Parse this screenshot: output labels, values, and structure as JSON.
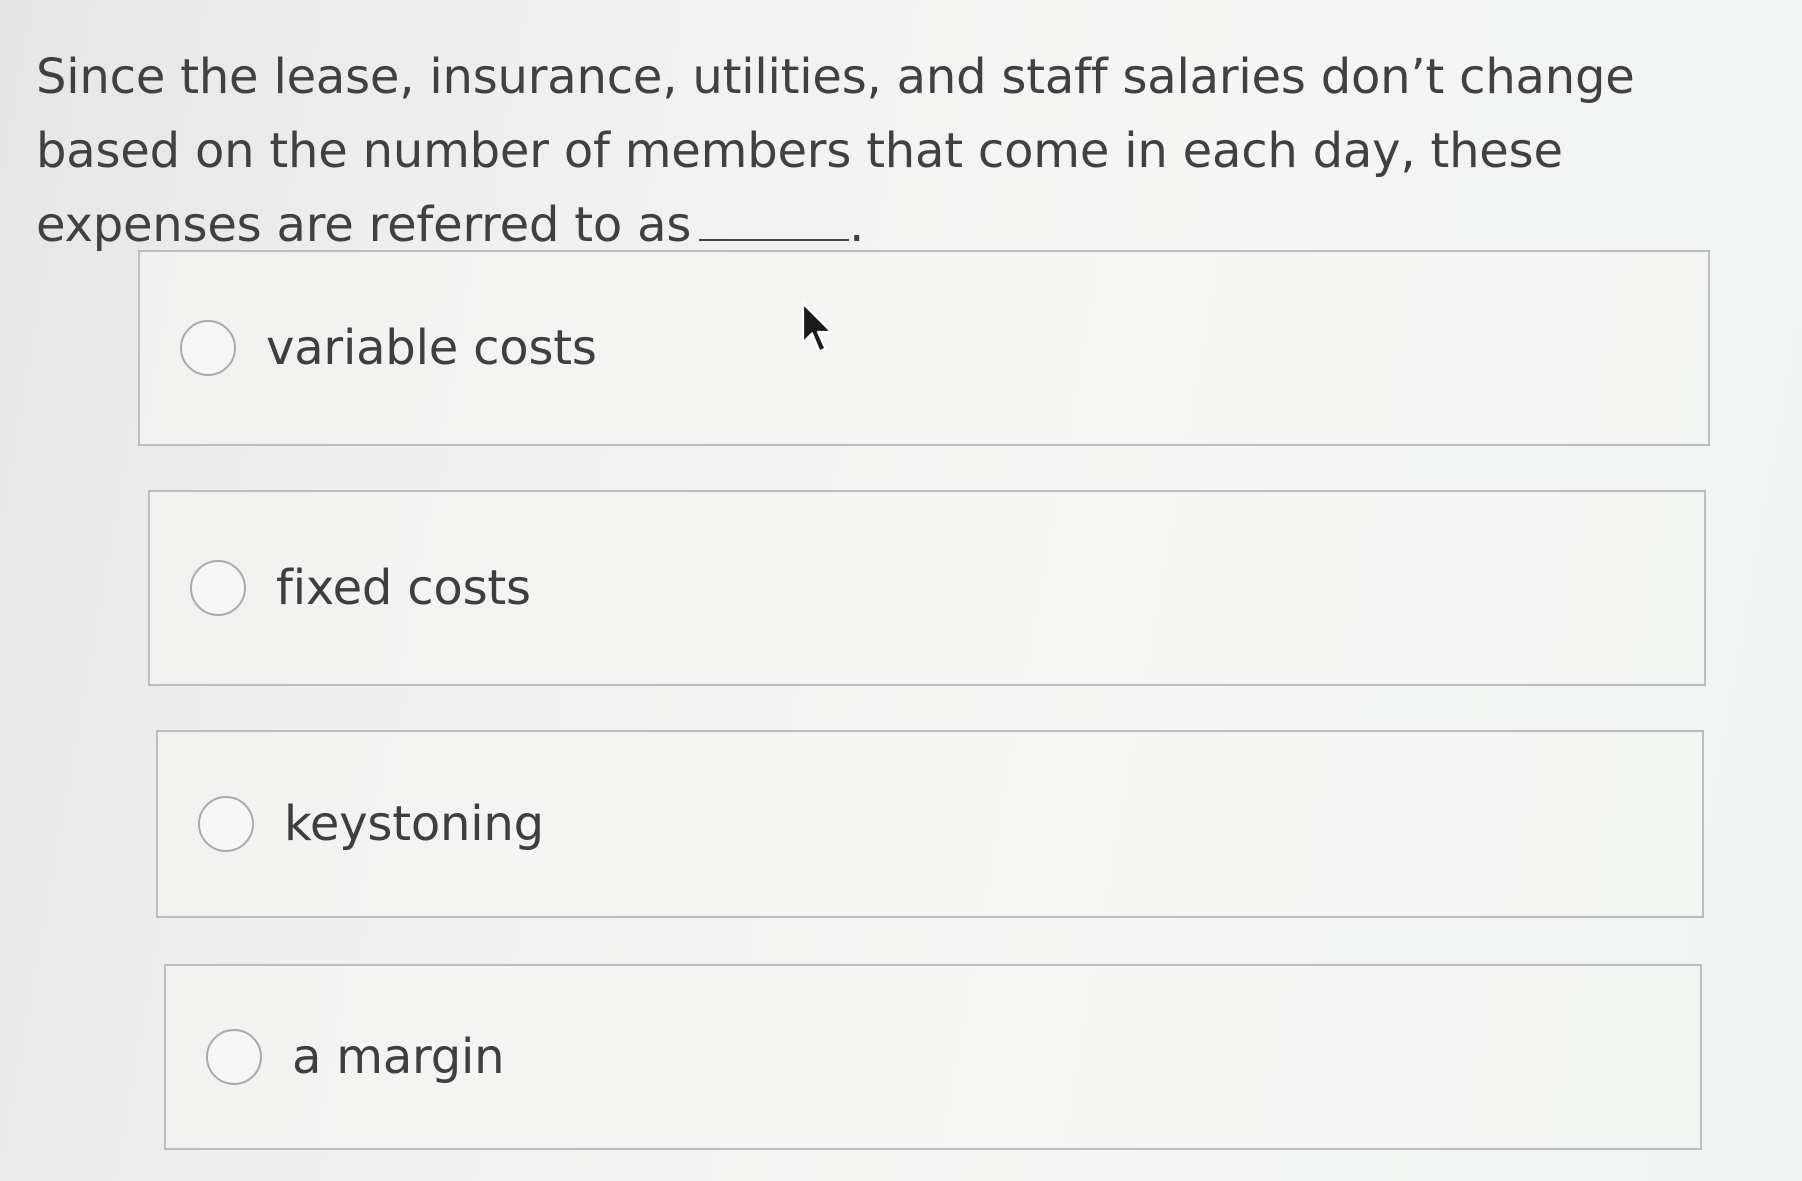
{
  "question": {
    "text": "Since the lease, insurance, utilities, and staff salaries don’t change based on the number of members that come in each day, these expenses are referred to as",
    "trailing_punct": "."
  },
  "options": [
    {
      "label": "variable costs",
      "selected": false
    },
    {
      "label": "fixed costs",
      "selected": false
    },
    {
      "label": "keystoning",
      "selected": false
    },
    {
      "label": "a margin",
      "selected": false
    }
  ],
  "icons": {
    "radio": "radio-unselected-icon",
    "cursor": "mouse-pointer-icon"
  },
  "colors": {
    "text": "#404040",
    "border": "#bdbdbd",
    "radio_border": "#a9a9a9"
  }
}
